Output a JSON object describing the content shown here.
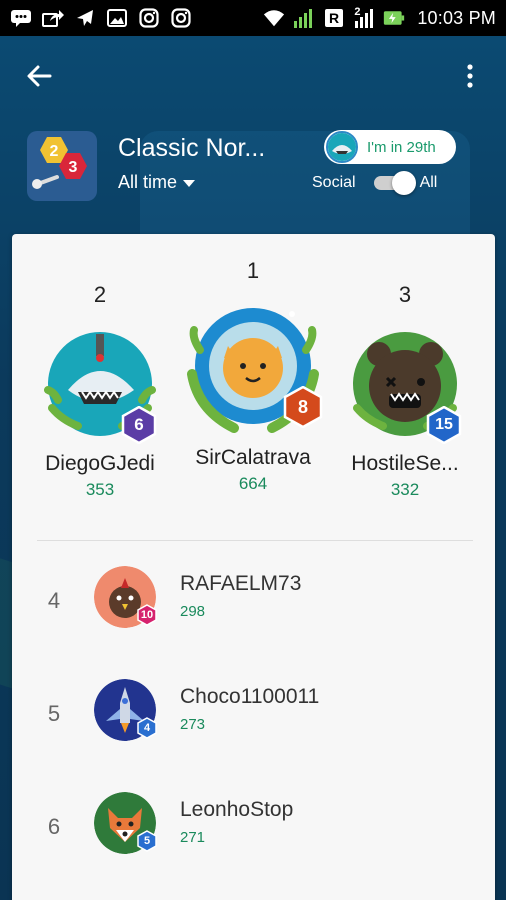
{
  "status_bar": {
    "time": "10:03 PM",
    "icons": [
      "message-icon",
      "share-icon",
      "flight-icon",
      "gallery-icon",
      "instagram-icon",
      "instagram-icon",
      "wifi-icon",
      "signal-icon",
      "r-icon",
      "signal-icon",
      "battery-charging-icon"
    ],
    "signal_label": "2"
  },
  "app_bar": {
    "back_icon": "arrow-left-icon",
    "more_icon": "more-vert-icon"
  },
  "header": {
    "title": "Classic Nor...",
    "time_filter": "All time",
    "my_rank": "I'm in 29th",
    "toggle_left": "Social",
    "toggle_right": "All",
    "game_icon_numbers": [
      "2",
      "3"
    ]
  },
  "podium": [
    {
      "rank": "2",
      "name": "DiegoGJedi",
      "score": "353",
      "level": "6",
      "level_color": "#5b3da6",
      "avatar_color": "#19a6b9"
    },
    {
      "rank": "1",
      "name": "SirCalatrava",
      "score": "664",
      "level": "8",
      "level_color": "#d44a1c",
      "avatar_color": "#1d8bd0"
    },
    {
      "rank": "3",
      "name": "HostileSe...",
      "score": "332",
      "level": "15",
      "level_color": "#2266c9",
      "avatar_color": "#4a9b40"
    }
  ],
  "list": [
    {
      "rank": "4",
      "name": "RAFAELM73",
      "score": "298",
      "level": "10",
      "level_color": "#d6226e",
      "avatar_color": "#ef8a6d"
    },
    {
      "rank": "5",
      "name": "Choco1100011",
      "score": "273",
      "level": "4",
      "level_color": "#2a6fd0",
      "avatar_color": "#22348f"
    },
    {
      "rank": "6",
      "name": "LeonhoStop",
      "score": "271",
      "level": "5",
      "level_color": "#2a6fd0",
      "avatar_color": "#2f7a3a"
    }
  ],
  "colors": {
    "accent": "#1a8a5c",
    "top_bar": "#0b4a72"
  }
}
